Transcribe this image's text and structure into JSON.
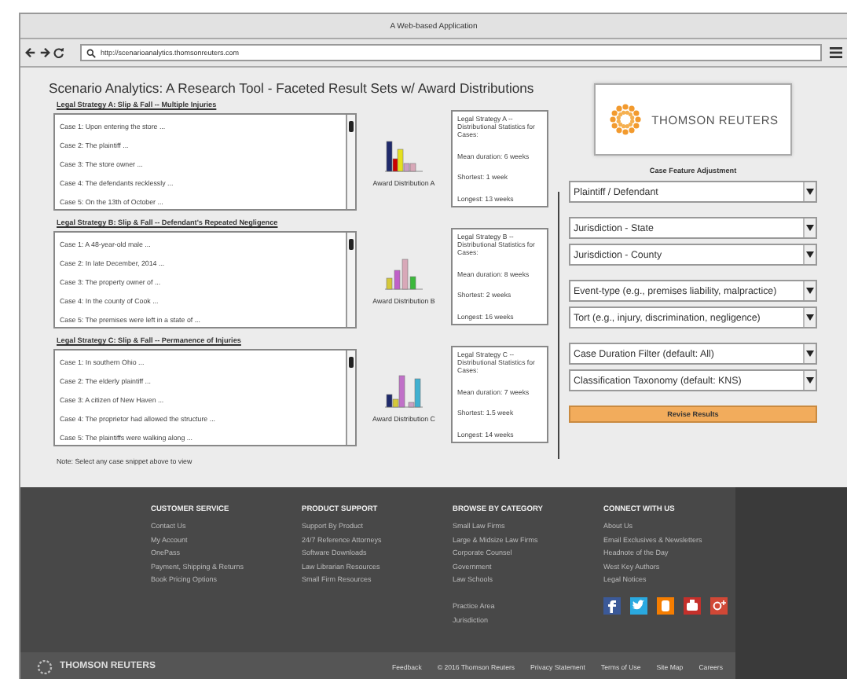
{
  "window": {
    "title": "A Web-based Application"
  },
  "address_bar": {
    "url": "http://scenarioanalytics.thomsonreuters.com"
  },
  "heading": "Scenario Analytics:  A Research Tool - Faceted Result Sets w/ Award Distributions",
  "strategies": [
    {
      "title": "Legal Strategy A:  Slip & Fall -- Multiple Injuries",
      "cases": [
        "Case 1: Upon entering the store ...",
        "Case 2: The plaintiff ...",
        "Case 3: The store owner ...",
        "Case 4: The defendants recklessly ...",
        "Case 5: On the 13th of October ..."
      ],
      "chart_label": "Award Distribution A",
      "stats": [
        "Legal Strategy A -- Distributional Statistics for Cases:",
        "Mean duration: 6 weeks",
        "Shortest: 1 week",
        "Longest: 13 weeks"
      ]
    },
    {
      "title": "Legal Strategy B: Slip & Fall -- Defendant's Repeated Negligence",
      "cases": [
        "Case 1: A 48-year-old male ...",
        "Case 2: In late December, 2014 ...",
        "Case 3: The property owner of ...",
        "Case 4: In the county of Cook ...",
        "Case 5: The premises were left in a state of ..."
      ],
      "chart_label": "Award Distribution B",
      "stats": [
        "Legal Strategy B -- Distributional Statistics for Cases:",
        "Mean duration: 8 weeks",
        "Shortest: 2 weeks",
        "Longest: 16 weeks"
      ]
    },
    {
      "title": "Legal Strategy C: Slip & Fall -- Permanence of Injuries",
      "cases": [
        "Case 1: In southern Ohio ...",
        "Case 2: The elderly plaintiff ...",
        "Case 3: A citizen of New Haven ...",
        "Case 4: The proprietor had allowed the structure ...",
        "Case 5: The plaintiffs were walking along ..."
      ],
      "chart_label": "Award Distribution C",
      "stats": [
        "Legal Strategy C -- Distributional Statistics for Cases:",
        "Mean duration: 7 weeks",
        "Shortest: 1.5 week",
        "Longest: 14 weeks"
      ]
    }
  ],
  "note": "Note: Select any case snippet above to view",
  "logo": {
    "brand": "THOMSON REUTERS"
  },
  "panel_title": "Case Feature Adjustment",
  "select_groups": [
    [
      "Plaintiff / Defendant"
    ],
    [
      "Jurisdiction - State",
      "Jurisdiction - County"
    ],
    [
      "Event-type (e.g., premises liability, malpractice)",
      "Tort (e.g., injury, discrimination, negligence)"
    ],
    [
      "Case Duration Filter (default: All)",
      "Classification Taxonomy (default: KNS)"
    ]
  ],
  "button": "Revise Results",
  "footer": {
    "columns": [
      {
        "heading": "CUSTOMER SERVICE",
        "links": [
          "Contact Us",
          "My Account",
          "OnePass",
          "Payment, Shipping & Returns",
          "Book Pricing Options"
        ]
      },
      {
        "heading": "PRODUCT SUPPORT",
        "links": [
          "Support By Product",
          "24/7 Reference Attorneys",
          "Software Downloads",
          "Law Librarian Resources",
          "Small Firm Resources"
        ]
      },
      {
        "heading": "BROWSE BY CATEGORY",
        "links": [
          "Small Law Firms",
          "Large & Midsize Law Firms",
          "Corporate Counsel",
          "Government",
          "Law Schools"
        ],
        "more_links": [
          "Practice Area",
          "Jurisdiction"
        ]
      },
      {
        "heading": "CONNECT WITH US",
        "links": [
          "About Us",
          "Email Exclusives & Newsletters",
          "Headnote of the Day",
          "West Key Authors",
          "Legal Notices"
        ]
      }
    ],
    "brand": "THOMSON REUTERS",
    "bottom_links": [
      "Feedback",
      "© 2016 Thomson Reuters",
      "Privacy Statement",
      "Terms of Use",
      "Site Map",
      "Careers"
    ]
  }
}
